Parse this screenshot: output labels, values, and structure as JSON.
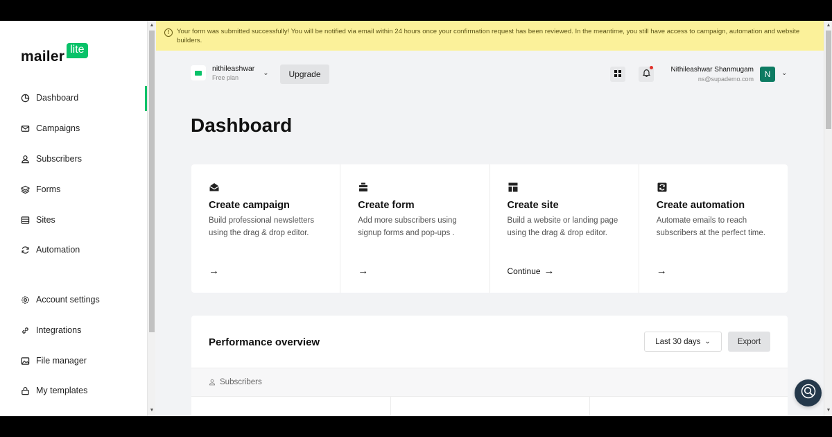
{
  "logo": {
    "main": "mailer",
    "badge": "lite"
  },
  "sidebar": {
    "items": [
      {
        "label": "Dashboard",
        "icon": "dashboard-icon"
      },
      {
        "label": "Campaigns",
        "icon": "mail-icon"
      },
      {
        "label": "Subscribers",
        "icon": "user-icon"
      },
      {
        "label": "Forms",
        "icon": "layers-icon"
      },
      {
        "label": "Sites",
        "icon": "site-icon"
      },
      {
        "label": "Automation",
        "icon": "refresh-icon"
      },
      {
        "label": "Account settings",
        "icon": "gear-icon"
      },
      {
        "label": "Integrations",
        "icon": "link-icon"
      },
      {
        "label": "File manager",
        "icon": "image-icon"
      },
      {
        "label": "My templates",
        "icon": "lock-icon"
      }
    ],
    "active": "Dashboard"
  },
  "banner": {
    "message": "Your form was submitted successfully! You will be notified via email within 24 hours once your confirmation request has been reviewed. In the meantime, you still have access to campaign, automation and website builders."
  },
  "account": {
    "name": "nithileashwar",
    "plan": "Free plan"
  },
  "topbar": {
    "upgrade_label": "Upgrade"
  },
  "user": {
    "name": "Nithileashwar Shanmugam",
    "email": "ns@supademo.com",
    "initial": "N"
  },
  "page": {
    "title": "Dashboard"
  },
  "cards": [
    {
      "title": "Create campaign",
      "description": "Build professional newsletters using the drag & drop editor.",
      "cta": ""
    },
    {
      "title": "Create form",
      "description": "Add more subscribers using signup forms and pop-ups .",
      "cta": ""
    },
    {
      "title": "Create site",
      "description": "Build a website or landing page using the drag & drop editor.",
      "cta": "Continue"
    },
    {
      "title": "Create automation",
      "description": "Automate emails to reach subscribers at the perfect time.",
      "cta": ""
    }
  ],
  "performance": {
    "title": "Performance overview",
    "period": "Last 30 days",
    "export_label": "Export",
    "tab_label": "Subscribers"
  },
  "colors": {
    "brand_green": "#09c269",
    "banner_yellow": "#fbf19a",
    "avatar_teal": "#0d7b62",
    "help_navy": "#24384a"
  }
}
